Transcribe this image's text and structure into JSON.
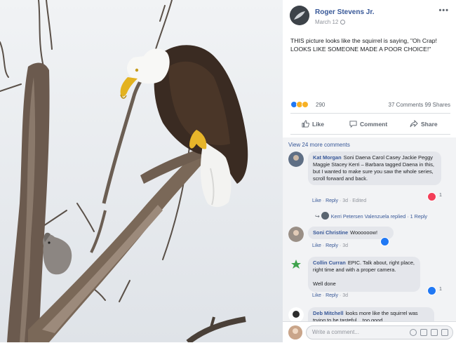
{
  "post": {
    "author": "Roger Stevens Jr.",
    "date": "March 12",
    "text": "THIS picture looks like the squirrel is saying, \"Oh Crap! LOOKS LIKE SOMEONE MADE A POOR CHOICE!\"",
    "reaction_count": "290",
    "comments_count": "37 Comments",
    "shares_count": "99 Shares"
  },
  "actions": {
    "like": "Like",
    "comment": "Comment",
    "share": "Share"
  },
  "view_more": "View 24 more comments",
  "comments": [
    {
      "name": "Kat Morgan",
      "text": "Soni Daena Carol Casey Jackie Peggy Maggie Stacey Kerri – Barbara tagged Daena in this, but I wanted to make sure you saw the whole series, scroll forward and back.",
      "like": "Like",
      "reply": "Reply",
      "time": "3d",
      "edited": "Edited",
      "react_count": "1"
    },
    {
      "reply_text": "Kerri Petersen Valenzuela replied · 1 Reply"
    },
    {
      "name": "Soni Christine",
      "text": "Woooooow!",
      "like": "Like",
      "reply": "Reply",
      "time": "3d",
      "react_count": "1"
    },
    {
      "name": "Collin Curran",
      "text": "EPIC. Talk about, right place, right time and with a proper camera.",
      "text2": "Well done",
      "like": "Like",
      "reply": "Reply",
      "time": "3d",
      "react_count": "1"
    },
    {
      "name": "Deb Mitchell",
      "text": "looks more like the squirrel was trying to be tasteful... too good"
    }
  ],
  "write_comment": {
    "placeholder": "Write a comment..."
  },
  "colors": {
    "link": "#385898",
    "like_blue": "#2078f4",
    "love_red": "#f33e58",
    "comment_bg": "#f2f3f5"
  }
}
